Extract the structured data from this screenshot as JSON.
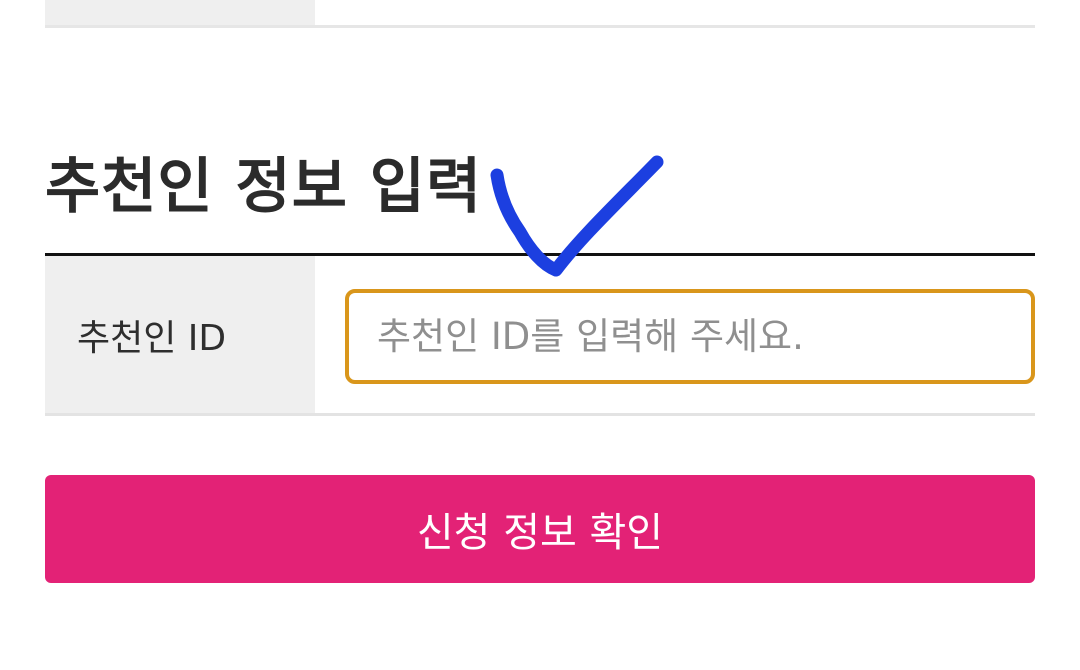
{
  "section": {
    "title": "추천인 정보 입력"
  },
  "form": {
    "recommender_id_label": "추천인 ID",
    "recommender_id_placeholder": "추천인 ID를 입력해 주세요.",
    "recommender_id_value": ""
  },
  "actions": {
    "confirm_label": "신청 정보 확인"
  },
  "colors": {
    "accent_button": "#e32276",
    "input_focus_border": "#d9961b",
    "annotation_mark": "#1c3fe0"
  },
  "annotation": {
    "icon": "handwritten-checkmark-icon"
  }
}
